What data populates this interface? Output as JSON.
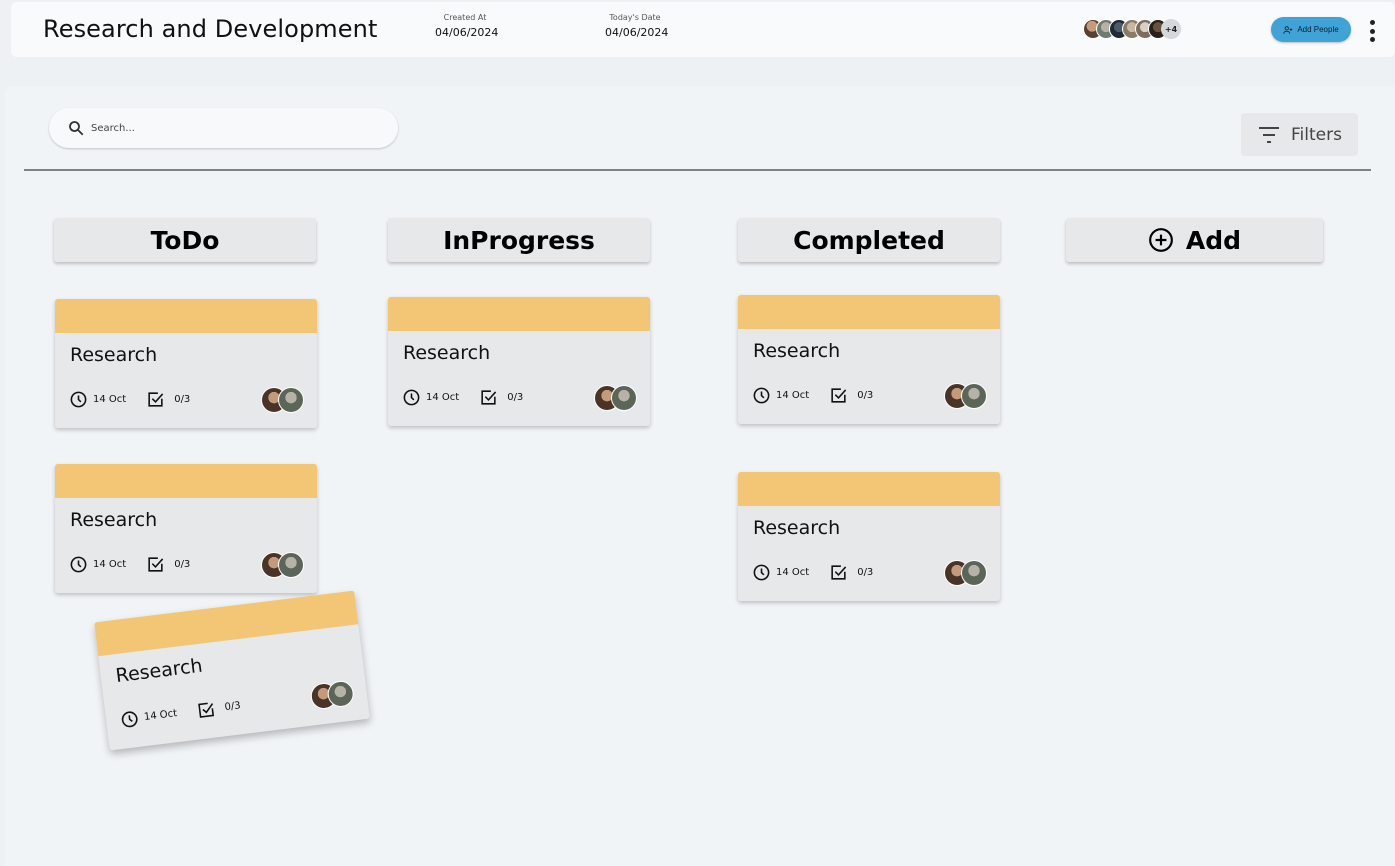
{
  "header": {
    "project_title": "Research and Development",
    "created_label": "Created At",
    "created_value": "04/06/2024",
    "today_label": "Today's Date",
    "today_value": "04/06/2024",
    "extra_members": "+4",
    "add_people_label": "Add People"
  },
  "toolbar": {
    "search_placeholder": "Search...",
    "filters_label": "Filters"
  },
  "columns": [
    {
      "title": "ToDo"
    },
    {
      "title": "InProgress"
    },
    {
      "title": "Completed"
    },
    {
      "title": "Add"
    }
  ],
  "cards": [
    {
      "title": "Research",
      "date": "14 Oct",
      "tasks": "0/3"
    },
    {
      "title": "Research",
      "date": "14 Oct",
      "tasks": "0/3"
    },
    {
      "title": "Research",
      "date": "14 Oct",
      "tasks": "0/3"
    },
    {
      "title": "Research",
      "date": "14 Oct",
      "tasks": "0/3"
    },
    {
      "title": "Research",
      "date": "14 Oct",
      "tasks": "0/3"
    },
    {
      "title": "Research",
      "date": "14 Oct",
      "tasks": "0/3"
    }
  ],
  "colors": {
    "card_band": "#f2c675",
    "accent_button": "#3fa3d8",
    "column_header": "#e6e8ea"
  },
  "icons": [
    "search-icon",
    "filter-icon",
    "clock-icon",
    "checkbox-icon",
    "add-circle-icon",
    "add-people-icon",
    "more-vert-icon"
  ]
}
